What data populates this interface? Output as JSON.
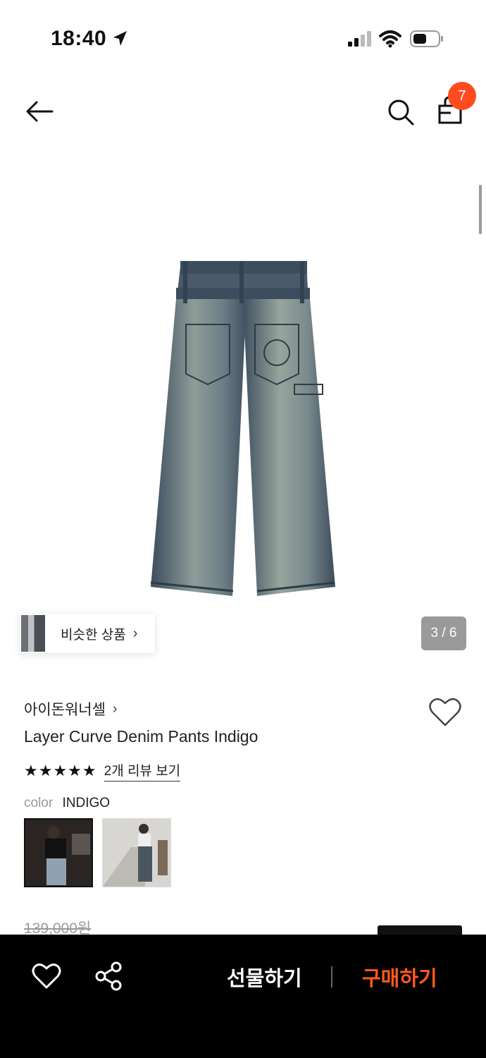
{
  "status_bar": {
    "time": "18:40"
  },
  "header": {
    "cart_count": "7"
  },
  "gallery": {
    "similar_label": "비슷한 상품",
    "page_indicator": "3 / 6"
  },
  "product": {
    "brand": "아이돈워너셀",
    "title": "Layer Curve Denim Pants Indigo",
    "rating_stars": "★★★★★",
    "review_link": "2개 리뷰 보기",
    "color_label": "color",
    "color_value": "INDIGO",
    "original_price": "139,000원"
  },
  "bottom_bar": {
    "gift_label": "선물하기",
    "buy_label": "구매하기"
  },
  "colors": {
    "accent": "#ff4b1f",
    "buy_text": "#ff5a1f",
    "bottom_bar_bg": "#000000"
  }
}
